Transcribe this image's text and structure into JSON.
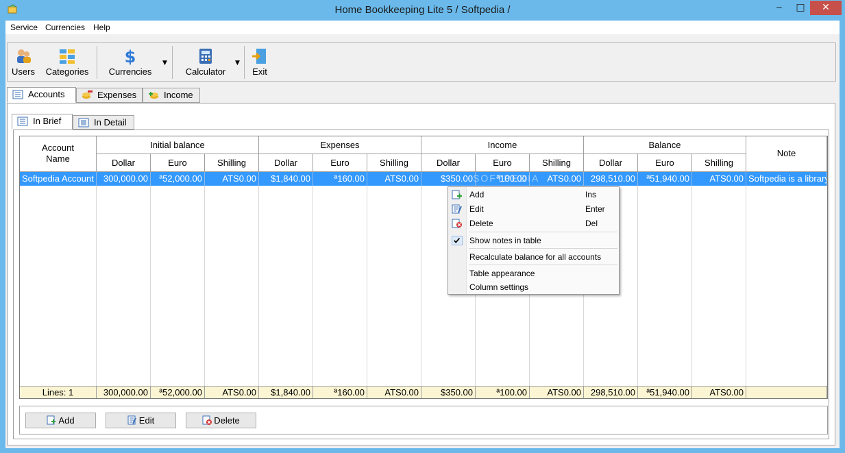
{
  "window": {
    "title": "Home Bookkeeping Lite 5  / Softpedia /",
    "minimize": "‒",
    "maximize": "□",
    "close": "✕"
  },
  "menu": [
    "Service",
    "Currencies",
    "Help"
  ],
  "toolbar": {
    "users": "Users",
    "categories": "Categories",
    "currencies": "Currencies",
    "calculator": "Calculator",
    "exit": "Exit",
    "dropdown": "▼"
  },
  "tabs": [
    "Accounts",
    "Expenses",
    "Income"
  ],
  "subtabs": [
    "In Brief",
    "In Detail"
  ],
  "table": {
    "account_header": "Account Name",
    "groups": [
      "Initial balance",
      "Expenses",
      "Income",
      "Balance"
    ],
    "note_header": "Note",
    "subheaders": [
      "Dollar",
      "Euro",
      "Shilling"
    ],
    "row": {
      "name": "Softpedia Account",
      "values": [
        "300,000.00",
        "ª52,000.00",
        "ATS0.00",
        "$1,840.00",
        "ª160.00",
        "ATS0.00",
        "$350.00",
        "ª100.00",
        "ATS0.00",
        "298,510.00",
        "ª51,940.00",
        "ATS0.00"
      ],
      "note": "Softpedia is a library"
    },
    "footer": {
      "lines": "Lines: 1",
      "values": [
        "300,000.00",
        "ª52,000.00",
        "ATS0.00",
        "$1,840.00",
        "ª160.00",
        "ATS0.00",
        "$350.00",
        "ª100.00",
        "ATS0.00",
        "298,510.00",
        "ª51,940.00",
        "ATS0.00"
      ]
    }
  },
  "buttons": {
    "add": "Add",
    "edit": "Edit",
    "delete": "Delete"
  },
  "context_menu": {
    "add": "Add",
    "add_key": "Ins",
    "edit": "Edit",
    "edit_key": "Enter",
    "delete": "Delete",
    "delete_key": "Del",
    "show_notes": "Show notes in table",
    "show_notes_checked": true,
    "recalculate": "Recalculate balance for all accounts",
    "appearance": "Table appearance",
    "column_settings": "Column settings"
  },
  "watermark": "SOFTPEDIA"
}
